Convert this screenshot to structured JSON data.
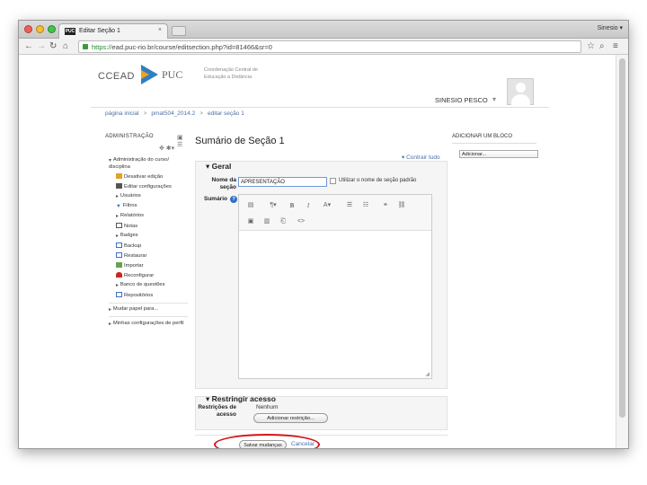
{
  "browser": {
    "tab_title": "Editar Seção 1",
    "tab_favicon": "PUC",
    "user_chip": "Sinesio ▾",
    "url_scheme": "https://",
    "url_rest": "ead.puc-rio.br/course/editsection.php?id=81466&sr=0"
  },
  "header": {
    "logo_text": "CCEAD",
    "logo_puc": "PUC",
    "logo_sub": "Coordenação Central de Educação a Distância",
    "user_name": "SINESIO PESCO"
  },
  "breadcrumb": [
    "página inicial",
    "pmat504_2014.2",
    "editar seção 1"
  ],
  "admin": {
    "title": "ADMINISTRAÇÃO",
    "items": [
      {
        "label": "Administração do curso/ disciplina",
        "icon": "caret-down-icon"
      },
      {
        "label": "Desativar edição",
        "icon": "pencil-icon"
      },
      {
        "label": "Editar configurações",
        "icon": "settings-icon"
      },
      {
        "label": "Usuários",
        "icon": "caret-right-icon"
      },
      {
        "label": "Filtros",
        "icon": "filter-icon"
      },
      {
        "label": "Relatórios",
        "icon": "caret-right-icon"
      },
      {
        "label": "Notas",
        "icon": "grades-icon"
      },
      {
        "label": "Badges",
        "icon": "caret-right-icon"
      },
      {
        "label": "Backup",
        "icon": "backup-icon"
      },
      {
        "label": "Restaurar",
        "icon": "restore-icon"
      },
      {
        "label": "Importar",
        "icon": "import-icon"
      },
      {
        "label": "Reconfigurar",
        "icon": "reset-icon"
      },
      {
        "label": "Banco de questões",
        "icon": "caret-right-icon"
      },
      {
        "label": "Repositórios",
        "icon": "repository-icon"
      },
      {
        "label": "Mudar papel para...",
        "icon": "caret-right-icon"
      },
      {
        "label": "Minhas configurações de perfil",
        "icon": "caret-right-icon"
      }
    ]
  },
  "main": {
    "title": "Sumário de Seção 1",
    "expand_all": "Contrair tudo",
    "general_legend": "Geral",
    "section_name_label": "Nome da seção",
    "section_name_value": "APRESENTAÇÃO",
    "use_default_label": "Utilizar o nome de seção padrão",
    "summary_label": "Sumário",
    "restrict_legend": "Restringir acesso",
    "restrictions_label": "Restrições de acesso",
    "restrictions_value": "Nenhum",
    "add_restriction": "Adicionar restrição...",
    "save": "Salvar mudanças",
    "cancel": "Cancelar"
  },
  "add_block": {
    "title": "ADICIONAR UM BLOCO",
    "select": "Adicionar..."
  },
  "colors": {
    "link": "#4a6fa5",
    "highlight_ring": "#d0161b",
    "input_focus": "#6f9ad8"
  }
}
